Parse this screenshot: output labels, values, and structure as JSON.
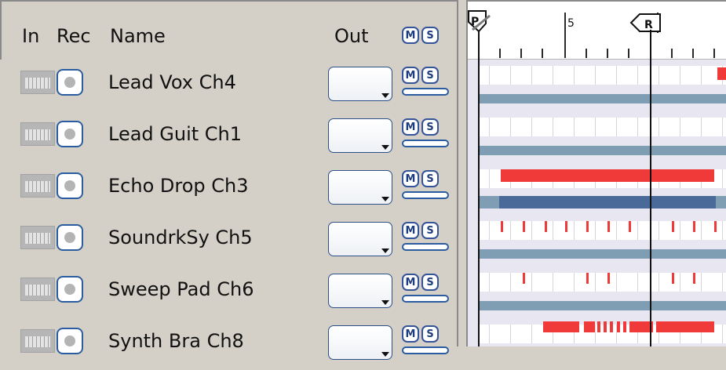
{
  "header": {
    "in_label": "In",
    "rec_label": "Rec",
    "name_label": "Name",
    "out_label": "Out",
    "mute_label": "M",
    "solo_label": "S"
  },
  "ruler": {
    "start_marker": "P",
    "end_marker": "R",
    "bar_number": "5"
  },
  "tracks": [
    {
      "name": "Lead Vox Ch4",
      "out": "",
      "mute": "M",
      "solo": "S"
    },
    {
      "name": "Lead Guit Ch1",
      "out": "",
      "mute": "M",
      "solo": "S"
    },
    {
      "name": "Echo Drop Ch3",
      "out": "",
      "mute": "M",
      "solo": "S"
    },
    {
      "name": "SoundrkSy Ch5",
      "out": "",
      "mute": "M",
      "solo": "S"
    },
    {
      "name": "Sweep Pad Ch6",
      "out": "",
      "mute": "M",
      "solo": "S"
    },
    {
      "name": "Synth Bra Ch8",
      "out": "",
      "mute": "M",
      "solo": "S"
    }
  ],
  "colors": {
    "panel": "#d4d0c8",
    "accent_blue": "#2b5c9f",
    "clip_red": "#f03a3a",
    "track_bar": "#7f9eb4",
    "track_bar_selected": "#4a6b99",
    "lane_tint": "#e8e6f0"
  }
}
